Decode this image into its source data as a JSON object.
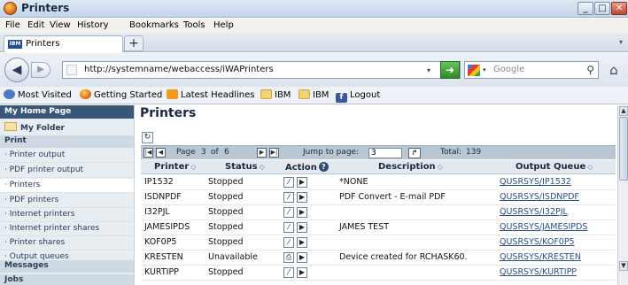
{
  "window": {
    "title": "Printers"
  },
  "menu": [
    "File",
    "Edit",
    "View",
    "History",
    "Bookmarks",
    "Tools",
    "Help"
  ],
  "tab": {
    "label": "Printers",
    "favicon_text": "IBM",
    "new_tab_label": "+"
  },
  "nav": {
    "url": "http://systemname/webaccess/iWAPrinters",
    "search_placeholder": "Google"
  },
  "bookmarks": [
    "Most Visited",
    "Getting Started",
    "Latest Headlines",
    "IBM",
    "IBM",
    "Logout"
  ],
  "sidebar": {
    "home": "My Home Page",
    "folder": "My Folder",
    "sections": [
      {
        "header": "Print",
        "items": [
          "Printer output",
          "PDF printer output",
          "Printers",
          "PDF printers",
          "Internet printers",
          "Internet printer shares",
          "Printer shares",
          "Output queues"
        ]
      },
      {
        "header": "Messages",
        "items": []
      },
      {
        "header": "Jobs",
        "items": []
      }
    ],
    "active_item": "Printers"
  },
  "main": {
    "title": "Printers",
    "pager": {
      "page_prefix": "Page",
      "page_current": "3",
      "page_of": "of",
      "page_total": "6",
      "jump_label": "Jump to page:",
      "jump_value": "3",
      "total_label": "Total:",
      "total_value": "139"
    },
    "columns": [
      "Printer",
      "Status",
      "Action",
      "Description",
      "Output Queue"
    ],
    "rows": [
      {
        "printer": "IP1532",
        "status": "Stopped",
        "description": "*NONE",
        "queue": "QUSRSYS/IP1532"
      },
      {
        "printer": "ISDNPDF",
        "status": "Stopped",
        "description": "PDF Convert - E-mail PDF",
        "queue": "QUSRSYS/ISDNPDF"
      },
      {
        "printer": "I32PJL",
        "status": "Stopped",
        "description": "",
        "queue": "QUSRSYS/I32PJL"
      },
      {
        "printer": "JAMESIPDS",
        "status": "Stopped",
        "description": "JAMES TEST",
        "queue": "QUSRSYS/JAMESIPDS"
      },
      {
        "printer": "KOF0P5",
        "status": "Stopped",
        "description": "",
        "queue": "QUSRSYS/KOF0P5"
      },
      {
        "printer": "KRESTEN",
        "status": "Unavailable",
        "description": "Device created for RCHASK60.",
        "queue": "QUSRSYS/KRESTEN"
      },
      {
        "printer": "KURTIPP",
        "status": "Stopped",
        "description": "",
        "queue": "QUSRSYS/KURTIPP"
      }
    ]
  }
}
